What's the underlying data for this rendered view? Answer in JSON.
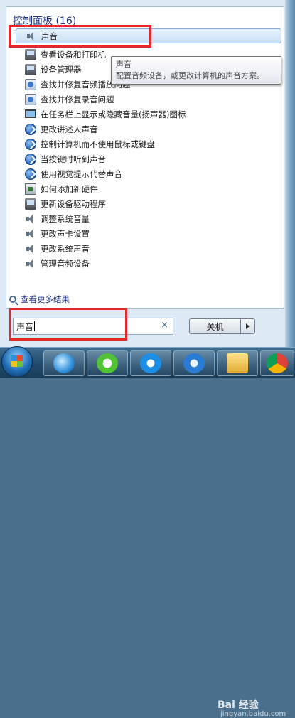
{
  "results": {
    "group_header": "控制面板 (16)",
    "items": [
      {
        "label": "声音",
        "icon": "speaker-icon"
      },
      {
        "label": "查看设备和打印机",
        "icon": "devices-printers-icon"
      },
      {
        "label": "设备管理器",
        "icon": "device-manager-icon"
      },
      {
        "label": "查找并修复音频播放问题",
        "icon": "troubleshoot-icon"
      },
      {
        "label": "查找并修复录音问题",
        "icon": "troubleshoot-icon"
      },
      {
        "label": "在任务栏上显示或隐藏音量(扬声器)图标",
        "icon": "taskbar-monitor-icon"
      },
      {
        "label": "更改讲述人声音",
        "icon": "ease-of-access-icon"
      },
      {
        "label": "控制计算机而不使用鼠标或键盘",
        "icon": "ease-of-access-icon"
      },
      {
        "label": "当按键时听到声音",
        "icon": "ease-of-access-icon"
      },
      {
        "label": "使用视觉提示代替声音",
        "icon": "ease-of-access-icon"
      },
      {
        "label": "如何添加新硬件",
        "icon": "add-hardware-icon"
      },
      {
        "label": "更新设备驱动程序",
        "icon": "device-manager-icon"
      },
      {
        "label": "调整系统音量",
        "icon": "speaker-icon"
      },
      {
        "label": "更改声卡设置",
        "icon": "speaker-icon"
      },
      {
        "label": "更改系统声音",
        "icon": "speaker-icon"
      },
      {
        "label": "管理音频设备",
        "icon": "speaker-icon"
      }
    ],
    "see_more": "查看更多结果"
  },
  "tooltip": {
    "title": "声音",
    "body": "配置音频设备，或更改计算机的声音方案。"
  },
  "search": {
    "value": "声音",
    "clear_icon": "×"
  },
  "shutdown": {
    "label": "关机"
  },
  "watermark": {
    "brand": "Bai 经验",
    "url": "jingyan.baidu.com"
  },
  "colors": {
    "highlight_box": "#e8262b",
    "header_text": "#1e3287"
  }
}
